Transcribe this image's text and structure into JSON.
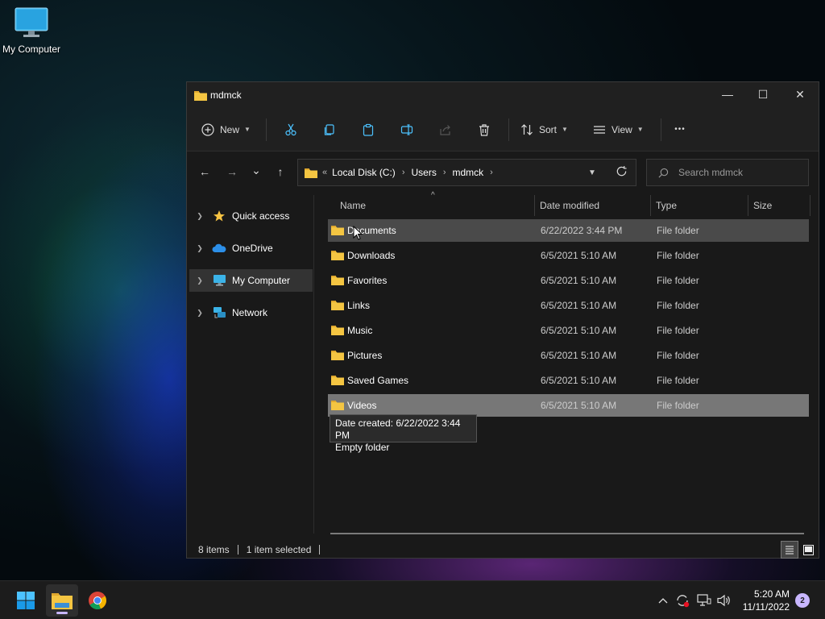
{
  "desktop": {
    "icon_label": "My Computer"
  },
  "window": {
    "title": "mdmck",
    "controls": {
      "minimize": "—",
      "maximize": "☐",
      "close": "✕"
    }
  },
  "toolbar": {
    "new_label": "New",
    "sort_label": "Sort",
    "view_label": "View",
    "more_label": "•••"
  },
  "navigation": {
    "back": "←",
    "forward": "→",
    "recent": "⌄",
    "up": "↑",
    "address_overflow": "«",
    "breadcrumb": [
      "Local Disk (C:)",
      "Users",
      "mdmck"
    ],
    "search_placeholder": "Search mdmck"
  },
  "sidebar": {
    "items": [
      {
        "label": "Quick access",
        "icon": "star-icon"
      },
      {
        "label": "OneDrive",
        "icon": "cloud-icon"
      },
      {
        "label": "My Computer",
        "icon": "computer-icon",
        "selected": true
      },
      {
        "label": "Network",
        "icon": "network-icon"
      }
    ]
  },
  "columns": {
    "name": "Name",
    "date": "Date modified",
    "type": "Type",
    "size": "Size"
  },
  "files": [
    {
      "name": "Documents",
      "date": "6/22/2022 3:44 PM",
      "type": "File folder"
    },
    {
      "name": "Downloads",
      "date": "6/5/2021 5:10 AM",
      "type": "File folder"
    },
    {
      "name": "Favorites",
      "date": "6/5/2021 5:10 AM",
      "type": "File folder"
    },
    {
      "name": "Links",
      "date": "6/5/2021 5:10 AM",
      "type": "File folder"
    },
    {
      "name": "Music",
      "date": "6/5/2021 5:10 AM",
      "type": "File folder"
    },
    {
      "name": "Pictures",
      "date": "6/5/2021 5:10 AM",
      "type": "File folder"
    },
    {
      "name": "Saved Games",
      "date": "6/5/2021 5:10 AM",
      "type": "File folder"
    },
    {
      "name": "Videos",
      "date": "6/5/2021 5:10 AM",
      "type": "File folder"
    }
  ],
  "tooltip": {
    "line1": "Date created: 6/22/2022 3:44 PM",
    "line2": "Empty folder"
  },
  "status": {
    "items_count": "8 items",
    "selection": "1 item selected"
  },
  "taskbar": {
    "clock_time": "5:20 AM",
    "clock_date": "11/11/2022",
    "notification_count": "2"
  },
  "colors": {
    "window_bg": "#191919",
    "selected_row": "#777777",
    "hover_row": "#4a4a4a",
    "folder_yellow": "#f4c542",
    "notification_badge": "#c8b6ff"
  }
}
